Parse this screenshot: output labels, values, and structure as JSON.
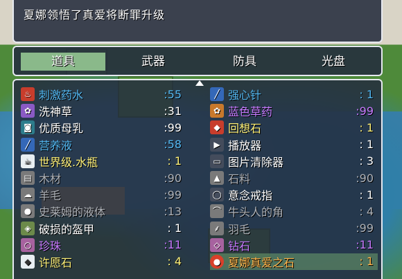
{
  "message": {
    "text": "夏娜领悟了真爱将断罪升级"
  },
  "categories": {
    "items": [
      "道具",
      "武器",
      "防具",
      "光盘"
    ],
    "active_index": 0
  },
  "inventory": {
    "left": [
      {
        "name": "刺激药水",
        "count": ":55",
        "color": "blue",
        "icon": "potion-icon"
      },
      {
        "name": "洗神草",
        "count": ":31",
        "color": "white",
        "icon": "herb-icon"
      },
      {
        "name": "优质母乳",
        "count": ":99",
        "color": "white",
        "icon": "milk-bottle-icon"
      },
      {
        "name": "营养液",
        "count": ":58",
        "color": "blue",
        "icon": "syringe-icon"
      },
      {
        "name": "世界级.水瓶",
        "count": ": 1",
        "color": "yellow",
        "icon": "cup-icon"
      },
      {
        "name": "木材",
        "count": ":90",
        "color": "gray",
        "icon": "wood-icon"
      },
      {
        "name": "羊毛",
        "count": ":99",
        "color": "gray",
        "icon": "wool-icon"
      },
      {
        "name": "史莱姆的液体",
        "count": ":13",
        "color": "gray",
        "icon": "slime-icon"
      },
      {
        "name": "破损的盔甲",
        "count": ": 1",
        "color": "white",
        "icon": "armor-icon"
      },
      {
        "name": "珍珠",
        "count": ":11",
        "color": "purple",
        "icon": "pearl-icon"
      },
      {
        "name": "许愿石",
        "count": ": 4",
        "color": "yellow",
        "icon": "wish-stone-icon"
      }
    ],
    "right": [
      {
        "name": "强心针",
        "count": ": 1",
        "color": "blue",
        "icon": "syringe-icon"
      },
      {
        "name": "蓝色草药",
        "count": ":99",
        "color": "purple",
        "icon": "herb-icon"
      },
      {
        "name": "回想石",
        "count": ": 1",
        "color": "yellow",
        "icon": "recall-stone-icon"
      },
      {
        "name": "播放器",
        "count": ": 1",
        "color": "white",
        "icon": "player-icon"
      },
      {
        "name": "图片清除器",
        "count": ": 3",
        "color": "white",
        "icon": "monitor-icon"
      },
      {
        "name": "石料",
        "count": ":90",
        "color": "gray",
        "icon": "stone-icon"
      },
      {
        "name": "意念戒指",
        "count": ": 1",
        "color": "white",
        "icon": "ring-icon"
      },
      {
        "name": "牛头人的角",
        "count": ": 4",
        "color": "gray",
        "icon": "horn-icon"
      },
      {
        "name": "羽毛",
        "count": ":99",
        "color": "gray",
        "icon": "feather-icon"
      },
      {
        "name": "钻石",
        "count": ":11",
        "color": "purple",
        "icon": "diamond-icon"
      },
      {
        "name": "夏娜真爱之石",
        "count": ": 1",
        "color": "orange",
        "icon": "love-stone-icon",
        "selected": true
      }
    ]
  }
}
